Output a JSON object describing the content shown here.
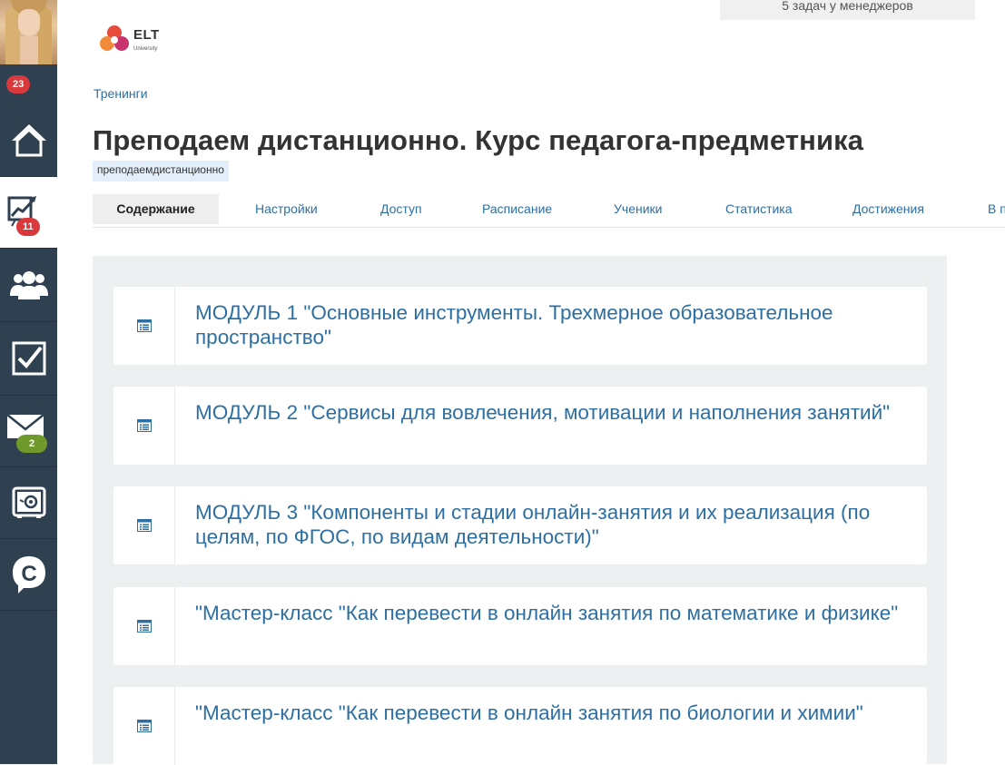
{
  "sidebar": {
    "badges": {
      "top": "23",
      "trainings": "11",
      "messages": "2"
    },
    "items": [
      {
        "name": "home",
        "icon": "home-icon"
      },
      {
        "name": "trainings",
        "icon": "chart-board-icon"
      },
      {
        "name": "users",
        "icon": "users-icon"
      },
      {
        "name": "tasks",
        "icon": "checkbox-icon"
      },
      {
        "name": "messages",
        "icon": "envelope-icon"
      },
      {
        "name": "safe",
        "icon": "safe-icon"
      },
      {
        "name": "chat",
        "icon": "chat-c-icon"
      }
    ]
  },
  "tasks_box": {
    "label": "5 задач у менеджеров"
  },
  "logo": {
    "text": "ELT",
    "sub": "University"
  },
  "breadcrumb": "Тренинги",
  "title": "Преподаем дистанционно. Курс педагога-предметника",
  "tag": "преподаемдистанционно",
  "tabs": [
    "Содержание",
    "Настройки",
    "Доступ",
    "Расписание",
    "Ученики",
    "Статистика",
    "Достижения",
    "В п"
  ],
  "modules": [
    "МОДУЛЬ 1 \"Основные инструменты. Трехмерное образовательное пространство\"",
    "МОДУЛЬ 2 \"Сервисы для вовлечения, мотивации и наполнения занятий\"",
    "МОДУЛЬ 3 \"Компоненты и стадии онлайн-занятия и их реализация (по целям, по ФГОС, по видам деятельности)\"",
    "\"Мастер-класс \"Как перевести в онлайн занятия по математике и физике\"",
    "\"Мастер-класс \"Как перевести в онлайн занятия по биологии и химии\""
  ],
  "colors": {
    "sidebar": "#2f4050",
    "link": "#2d6fa3",
    "badge_red": "#d9393a",
    "badge_green": "#6f9a2b",
    "panel": "#ecf0f1"
  }
}
